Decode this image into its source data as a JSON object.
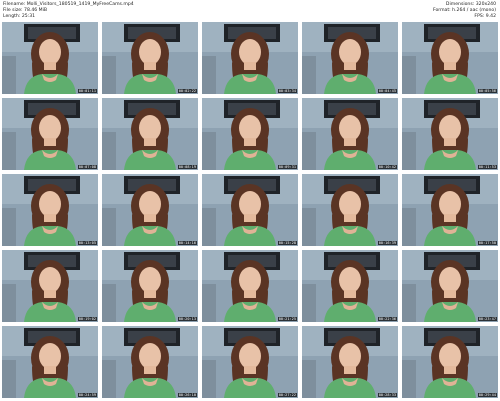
{
  "info": {
    "filename": "Filename: Molli_Visitors_180519_1419_MyFreeCams.mp4",
    "filesize": "File size: 78.46 MiB",
    "length": "Length: 25:31",
    "dimensions": "Dimensions: 320x240",
    "format": "Format: h.264 / aac (mono)",
    "fps": "FPS: 9.42"
  },
  "thumbnails": [
    {
      "time": "00:01:11"
    },
    {
      "time": "00:02:22"
    },
    {
      "time": "00:03:34"
    },
    {
      "time": "00:04:45"
    },
    {
      "time": "00:05:56"
    },
    {
      "time": "00:07:08"
    },
    {
      "time": "00:08:19"
    },
    {
      "time": "00:09:31"
    },
    {
      "time": "00:10:42"
    },
    {
      "time": "00:11:53"
    },
    {
      "time": "00:13:05"
    },
    {
      "time": "00:14:16"
    },
    {
      "time": "00:15:28"
    },
    {
      "time": "00:16:39"
    },
    {
      "time": "00:17:50"
    },
    {
      "time": "00:19:02"
    },
    {
      "time": "00:20:13"
    },
    {
      "time": "00:21:25"
    },
    {
      "time": "00:22:36"
    },
    {
      "time": "00:23:47"
    },
    {
      "time": "00:24:59"
    },
    {
      "time": "00:26:10"
    },
    {
      "time": "00:27:22"
    },
    {
      "time": "00:28:33"
    },
    {
      "time": "00:29:44"
    }
  ]
}
